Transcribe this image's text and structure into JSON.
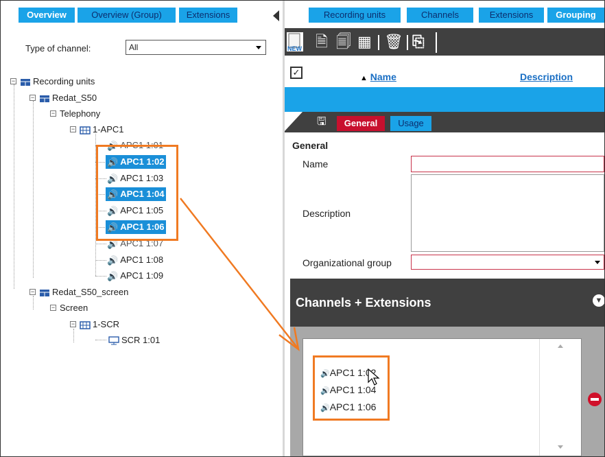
{
  "left_tabs": [
    "Overview",
    "Overview (Group)",
    "Extensions"
  ],
  "right_tabs": [
    "Recording units",
    "Channels",
    "Extensions",
    "Grouping"
  ],
  "filter": {
    "label": "Type of channel:",
    "value": "All"
  },
  "tree": {
    "root": "Recording units",
    "unit1": "Redat_S50",
    "unit1_type": "Telephony",
    "unit1_board": "1-APC1",
    "channels": [
      "APC1 1:01",
      "APC1 1:02",
      "APC1 1:03",
      "APC1 1:04",
      "APC1 1:05",
      "APC1 1:06",
      "APC1 1:07",
      "APC1 1:08",
      "APC1 1:09"
    ],
    "unit2": "Redat_S50_screen",
    "unit2_type": "Screen",
    "unit2_board": "1-SCR",
    "screen_channel": "SCR 1:01"
  },
  "toolbar": {
    "new_label": "NEW"
  },
  "grid": {
    "col_name": "Name",
    "col_description": "Description",
    "sort_indicator": "▲"
  },
  "detail_tabs": {
    "general": "General",
    "usage": "Usage"
  },
  "form": {
    "section": "General",
    "name_label": "Name",
    "description_label": "Description",
    "org_label": "Organizational group"
  },
  "channels_extensions": {
    "title": "Channels + Extensions",
    "items": [
      "APC1 1:02",
      "APC1 1:04",
      "APC1 1:06"
    ]
  },
  "colors": {
    "tab_blue": "#1aa3e8",
    "selection_blue": "#1a8fd8",
    "highlight_orange": "#f07a22",
    "dark_panel": "#404040",
    "active_tab_red": "#c8102e"
  }
}
